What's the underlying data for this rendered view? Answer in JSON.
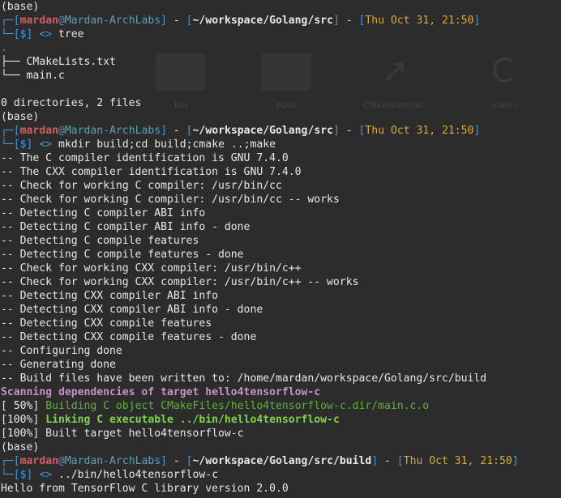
{
  "prompt": {
    "user": "mardan",
    "at": "@",
    "host": "Mardan-ArchLabs",
    "dollar": "$",
    "arrow": "<>",
    "date": "Thu Oct 31, 21:50",
    "paths": [
      "~/workspace/Golang/src",
      "~/workspace/Golang/src/build"
    ]
  },
  "env": "(base)",
  "commands": [
    "tree",
    "mkdir build;cd build;cmake ..;make",
    "../bin/hello4tensorflow-c"
  ],
  "tree": {
    "root": ".",
    "entries": [
      "CMakeLists.txt",
      "main.c"
    ],
    "summary": "0 directories, 2 files"
  },
  "cmake_output": [
    "-- The C compiler identification is GNU 7.4.0",
    "-- The CXX compiler identification is GNU 7.4.0",
    "-- Check for working C compiler: /usr/bin/cc",
    "-- Check for working C compiler: /usr/bin/cc -- works",
    "-- Detecting C compiler ABI info",
    "-- Detecting C compiler ABI info - done",
    "-- Detecting C compile features",
    "-- Detecting C compile features - done",
    "-- Check for working CXX compiler: /usr/bin/c++",
    "-- Check for working CXX compiler: /usr/bin/c++ -- works",
    "-- Detecting CXX compiler ABI info",
    "-- Detecting CXX compiler ABI info - done",
    "-- Detecting CXX compile features",
    "-- Detecting CXX compile features - done",
    "-- Configuring done",
    "-- Generating done",
    "-- Build files have been written to: /home/mardan/workspace/Golang/src/build"
  ],
  "make_output": {
    "scanning": "Scanning dependencies of target hello4tensorflow-c",
    "building_pct": "[ 50%]",
    "building": "Building C object CMakeFiles/hello4tensorflow-c.dir/main.c.o",
    "linking_pct": "[100%]",
    "linking": "Linking C executable ../bin/hello4tensorflow-c",
    "built": "[100%] Built target hello4tensorflow-c"
  },
  "program_output": "Hello from TensorFlow C library version 2.0.0",
  "background": {
    "labels": [
      "bin",
      "build",
      "CMakeLists.txt",
      "main.c"
    ]
  },
  "colors": {
    "background": "#2c2c2c",
    "text": "#e8e8e8",
    "bracket": "#3f9bd9",
    "user": "#cf5e5e",
    "host": "#5e9fb6",
    "date": "#d6a93c",
    "scanning": "#c592c5",
    "building": "#5fb33a",
    "linking": "#7fd348"
  }
}
